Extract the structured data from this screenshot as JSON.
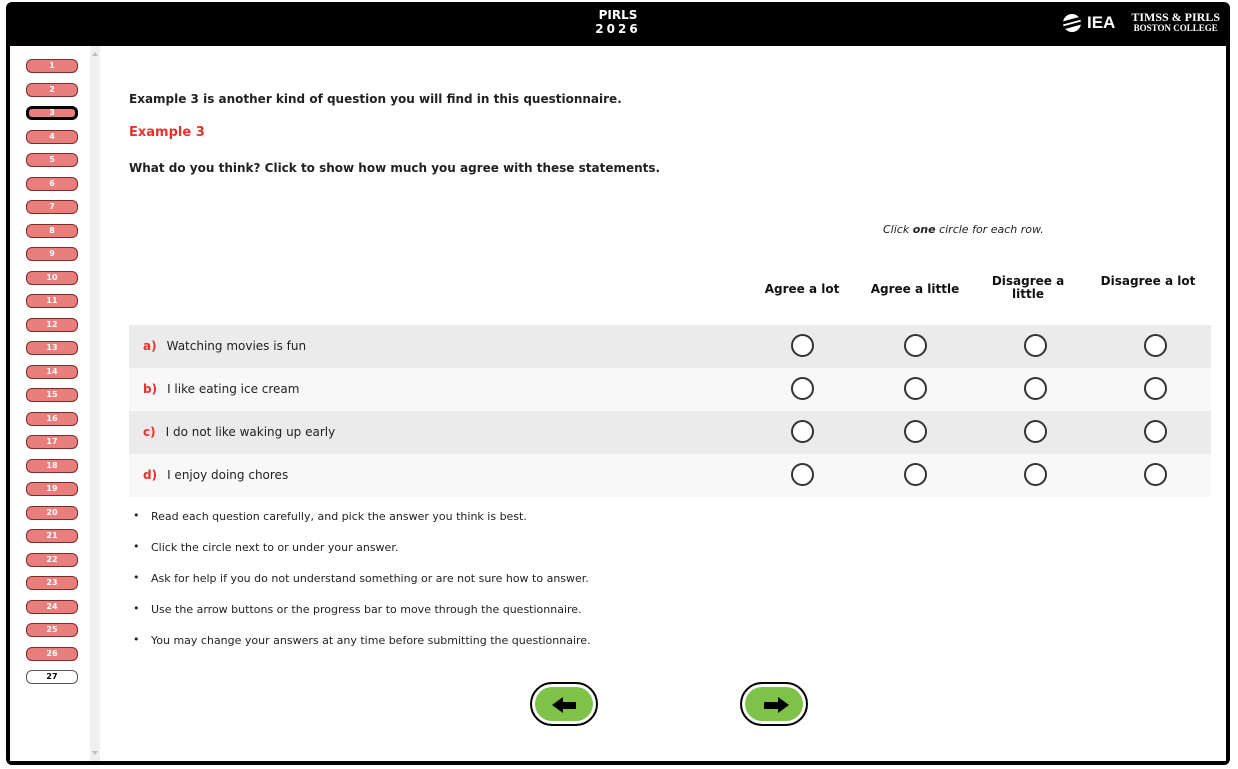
{
  "header": {
    "brand_line1": "PIRLS",
    "brand_line2": "2026",
    "iea_label": "IEA",
    "timss_line1": "TIMSS & PIRLS",
    "timss_line2": "BOSTON COLLEGE"
  },
  "nav": {
    "items": [
      "1",
      "2",
      "3",
      "4",
      "5",
      "6",
      "7",
      "8",
      "9",
      "10",
      "11",
      "12",
      "13",
      "14",
      "15",
      "16",
      "17",
      "18",
      "19",
      "20",
      "21",
      "22",
      "23",
      "24",
      "25",
      "26",
      "27"
    ],
    "current": "3"
  },
  "main": {
    "intro": "Example 3 is another kind of question you will find in this questionnaire.",
    "example_label": "Example 3",
    "question": "What do you think? Click to show how much you agree with these statements.",
    "instruction_pre": "Click ",
    "instruction_bold": "one",
    "instruction_post": " circle for each row.",
    "columns": [
      "Agree a lot",
      "Agree a little",
      "Disagree a little",
      "Disagree a lot"
    ],
    "rows": [
      {
        "letter": "a)",
        "text": "Watching movies is fun"
      },
      {
        "letter": "b)",
        "text": "I like eating ice cream"
      },
      {
        "letter": "c)",
        "text": "I do not like waking up early"
      },
      {
        "letter": "d)",
        "text": "I enjoy doing chores"
      }
    ],
    "tips": [
      "Read each question carefully, and pick the answer you think is best.",
      "Click the circle next to or under your answer.",
      "Ask for help if you do not understand something or are not sure how to answer.",
      "Use the arrow buttons or the progress bar to move through the questionnaire.",
      "You may change your answers at any time before submitting the questionnaire."
    ]
  },
  "colors": {
    "accent_red": "#e8312b",
    "nav_red": "#e87f7c",
    "arrow_green": "#7fc24a"
  }
}
